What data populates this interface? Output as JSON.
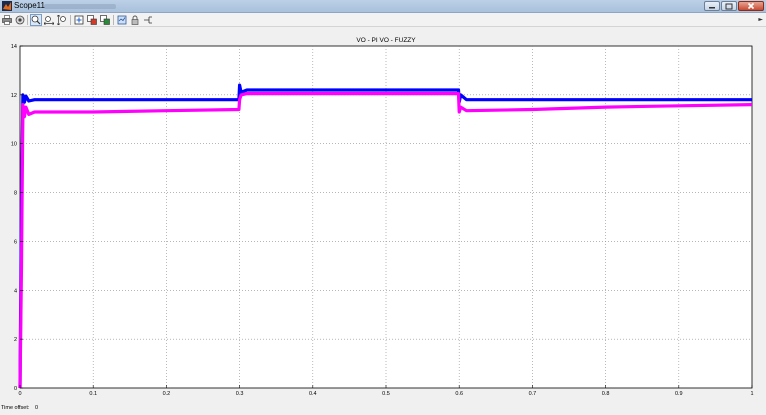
{
  "window": {
    "title": "Scope11"
  },
  "toolbar": {
    "buttons": [
      {
        "name": "print-icon"
      },
      {
        "name": "parameters-icon"
      },
      {
        "name": "zoom-icon",
        "pressed": true
      },
      {
        "name": "zoom-x-icon"
      },
      {
        "name": "zoom-y-icon"
      },
      {
        "name": "autoscale-icon"
      },
      {
        "name": "save-axes-settings-icon"
      },
      {
        "name": "restore-axes-settings-icon"
      },
      {
        "name": "floating-scope-icon"
      },
      {
        "name": "lock-axes-icon"
      },
      {
        "name": "signal-selection-icon"
      }
    ]
  },
  "footer": {
    "time_offset_label": "Time offset:",
    "time_offset_value": "0"
  },
  "chart_data": {
    "type": "line",
    "title": "VO - PI  VO - FUZZY",
    "xlim": [
      0,
      1
    ],
    "ylim": [
      0,
      14
    ],
    "x_ticks": [
      "0",
      "0.1",
      "0.2",
      "0.3",
      "0.4",
      "0.5",
      "0.6",
      "0.7",
      "0.8",
      "0.9",
      "1"
    ],
    "y_ticks": [
      "0",
      "2",
      "4",
      "6",
      "8",
      "10",
      "12",
      "14"
    ],
    "grid": true,
    "colors": {
      "series1": "#0000ff",
      "series2": "#ff00ff",
      "background": "#ffffff"
    },
    "series": [
      {
        "x": [
          0,
          0.002,
          0.004,
          0.006,
          0.008,
          0.012,
          0.02,
          0.05,
          0.1,
          0.2,
          0.299,
          0.3,
          0.302,
          0.31,
          0.4,
          0.5,
          0.599,
          0.6,
          0.602,
          0.61,
          0.7,
          0.8,
          0.9,
          1.0
        ],
        "y": [
          0,
          7.5,
          12.0,
          11.7,
          11.95,
          11.75,
          11.8,
          11.8,
          11.8,
          11.8,
          11.8,
          12.4,
          12.1,
          12.2,
          12.2,
          12.2,
          12.2,
          11.7,
          12.0,
          11.8,
          11.8,
          11.8,
          11.8,
          11.8
        ]
      },
      {
        "x": [
          0,
          0.002,
          0.004,
          0.006,
          0.008,
          0.012,
          0.02,
          0.05,
          0.1,
          0.2,
          0.299,
          0.3,
          0.302,
          0.31,
          0.4,
          0.5,
          0.599,
          0.6,
          0.602,
          0.61,
          0.7,
          0.8,
          0.9,
          1.0
        ],
        "y": [
          0,
          5.0,
          11.6,
          11.1,
          11.5,
          11.2,
          11.3,
          11.3,
          11.3,
          11.35,
          11.4,
          11.8,
          12.0,
          12.05,
          12.05,
          12.05,
          12.05,
          11.3,
          11.5,
          11.35,
          11.4,
          11.5,
          11.55,
          11.6
        ]
      }
    ]
  }
}
